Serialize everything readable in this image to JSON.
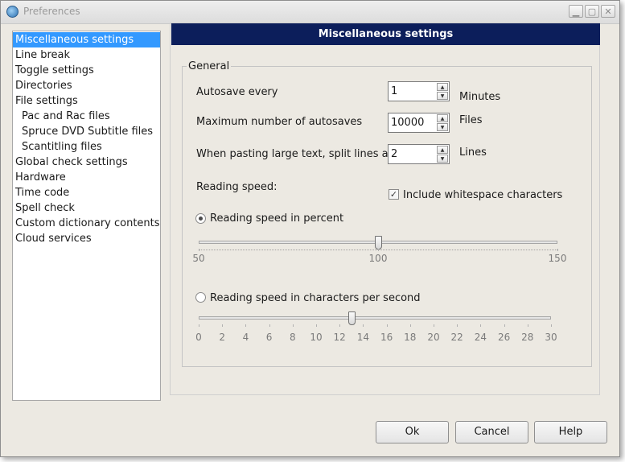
{
  "window": {
    "title": "Preferences"
  },
  "nav": {
    "items": [
      {
        "label": "Miscellaneous settings",
        "selected": true,
        "sub": false
      },
      {
        "label": "Line break",
        "sub": false
      },
      {
        "label": "Toggle settings",
        "sub": false
      },
      {
        "label": "Directories",
        "sub": false
      },
      {
        "label": "File settings",
        "sub": false
      },
      {
        "label": "Pac and Rac files",
        "sub": true
      },
      {
        "label": "Spruce DVD Subtitle files",
        "sub": true
      },
      {
        "label": "Scantitling files",
        "sub": true
      },
      {
        "label": "Global check settings",
        "sub": false
      },
      {
        "label": "Hardware",
        "sub": false
      },
      {
        "label": "Time code",
        "sub": false
      },
      {
        "label": "Spell check",
        "sub": false
      },
      {
        "label": "Custom dictionary contents",
        "sub": false
      },
      {
        "label": "Cloud services",
        "sub": false
      }
    ]
  },
  "panel": {
    "header": "Miscellaneous settings",
    "group_label": "General",
    "autosave": {
      "label": "Autosave every",
      "value": "1",
      "unit": "Minutes"
    },
    "max_autosaves": {
      "label": "Maximum number of autosaves",
      "value": "10000",
      "unit": "Files"
    },
    "split_lines": {
      "label": "When pasting large text, split lines at:",
      "value": "2",
      "unit": "Lines"
    },
    "reading_speed_label": "Reading speed:",
    "include_whitespace": {
      "label": "Include whitespace characters",
      "checked": true
    },
    "percent_option": {
      "label": "Reading speed in percent",
      "selected": true,
      "value": 100,
      "min": 50,
      "max": 150,
      "tick_labels": [
        "50",
        "100",
        "150"
      ]
    },
    "cps_option": {
      "label": "Reading speed in characters per second",
      "selected": false,
      "value": 13,
      "min": 0,
      "max": 30,
      "tick_labels": [
        "0",
        "2",
        "4",
        "6",
        "8",
        "10",
        "12",
        "14",
        "16",
        "18",
        "20",
        "22",
        "24",
        "26",
        "28",
        "30"
      ]
    }
  },
  "buttons": {
    "ok": "Ok",
    "cancel": "Cancel",
    "help": "Help"
  },
  "icons": [
    "app-icon",
    "minimize-icon",
    "maximize-icon",
    "close-icon",
    "spin-up-icon",
    "spin-down-icon",
    "checkmark-icon"
  ],
  "colors": {
    "selection": "#3399ff",
    "header_bg": "#0c1e5b",
    "dialog_bg": "#ece9e2"
  }
}
